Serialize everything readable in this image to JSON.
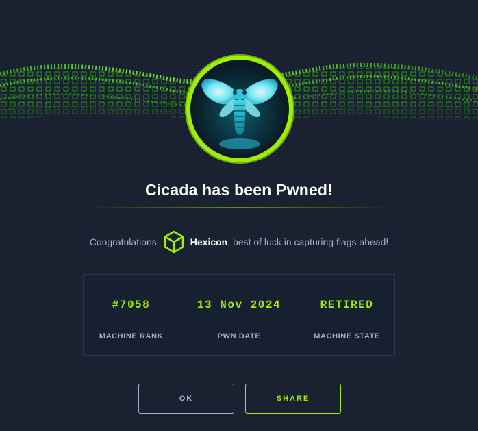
{
  "dialog": {
    "title": "Cicada has been Pwned!",
    "congrats_prefix": "Congratulations",
    "username": "Hexicon",
    "congrats_suffix": ", best of luck in capturing flags ahead!"
  },
  "stats": [
    {
      "value": "#7058",
      "label": "MACHINE RANK"
    },
    {
      "value": "13 Nov 2024",
      "label": "PWN DATE"
    },
    {
      "value": "RETIRED",
      "label": "MACHINE STATE"
    }
  ],
  "buttons": {
    "ok_label": "OK",
    "share_label": "SHARE"
  },
  "icons": {
    "avatar": "cicada-machine-avatar",
    "user_badge": "cube-icon",
    "banner": "green-wave-cubes"
  },
  "colors": {
    "background": "#1a2130",
    "accent": "#9fef00",
    "muted_text": "#a4b1cd",
    "title_text": "#ffffff",
    "panel_border": "#2b3548"
  }
}
